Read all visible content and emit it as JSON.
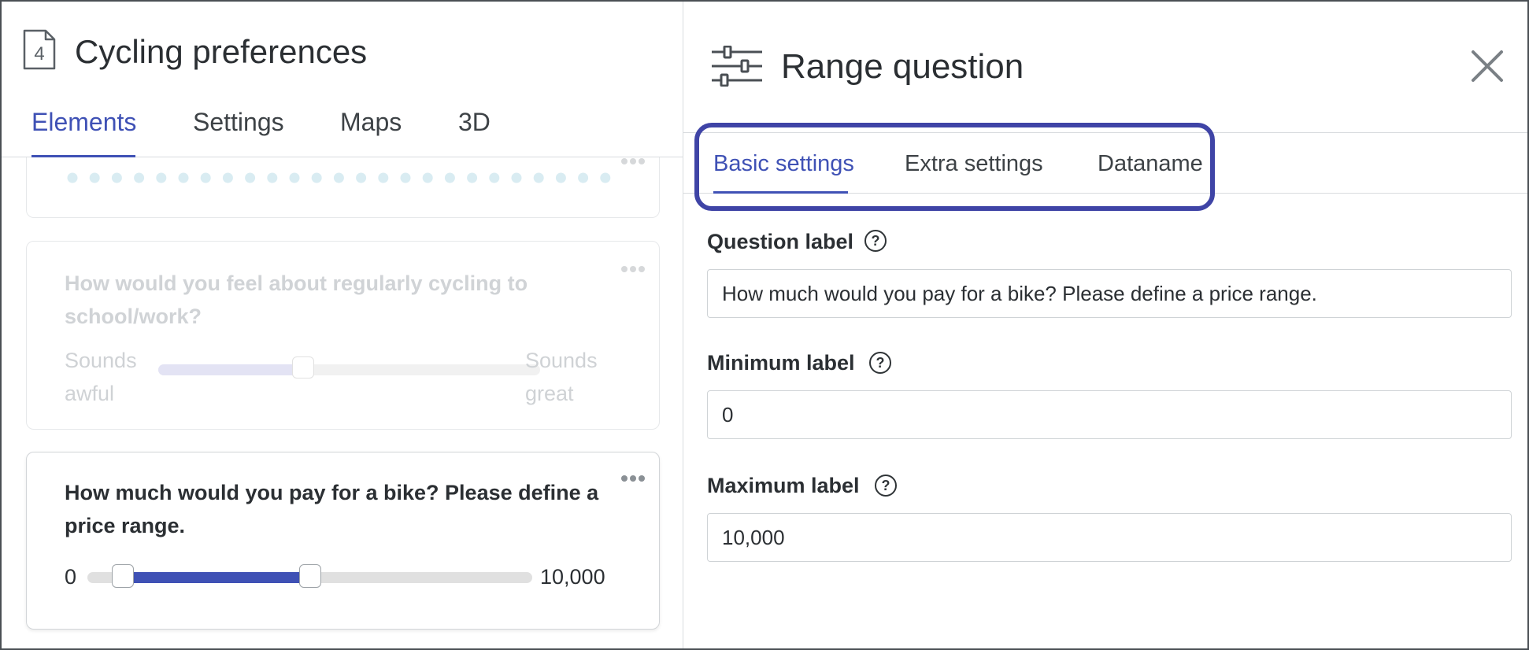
{
  "form": {
    "title": "Cycling preferences",
    "page_number": "4"
  },
  "left_tabs": {
    "elements": "Elements",
    "settings": "Settings",
    "maps": "Maps",
    "3d": "3D"
  },
  "elements": {
    "feel_question": {
      "label": "How would you feel about regularly cycling to school/work?",
      "min_label": "Sounds awful",
      "max_label": "Sounds great",
      "value_fraction": 0.38
    },
    "bike_question": {
      "label": "How much would you pay for a bike? Please define a price range.",
      "min_label": "0",
      "max_label": "10,000",
      "range_low_fraction": 0.08,
      "range_high_fraction": 0.5
    }
  },
  "panel": {
    "title": "Range question",
    "tabs": {
      "basic": "Basic settings",
      "extra": "Extra settings",
      "dataname": "Dataname"
    },
    "fields": {
      "question_label": {
        "label": "Question label",
        "value": "How much would you pay for a bike? Please define a price range."
      },
      "minimum_label": {
        "label": "Minimum label",
        "value": "0"
      },
      "maximum_label": {
        "label": "Maximum label",
        "value": "10,000"
      }
    },
    "help_glyph": "?"
  },
  "colors": {
    "accent": "#3f51b5",
    "highlight_outline": "#3f44a6",
    "faded_text": "#d0d3d6"
  }
}
